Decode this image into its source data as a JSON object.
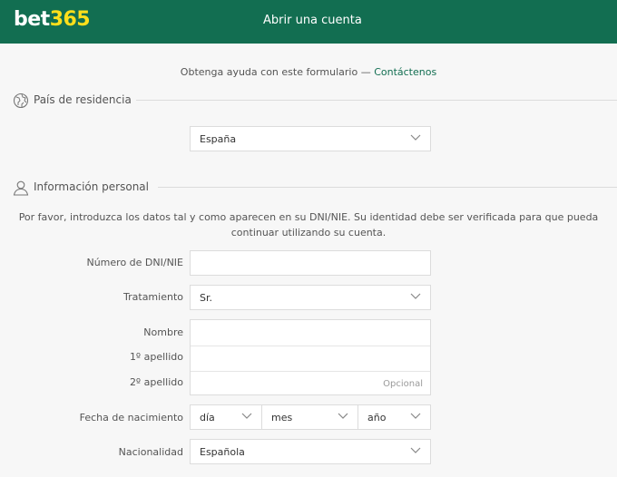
{
  "header": {
    "logo_part1": "bet",
    "logo_part2": "365",
    "title": "Abrir una cuenta",
    "bg_color": "#126e51",
    "logo_accent": "#ffdf1b"
  },
  "help": {
    "text": "Obtenga ayuda con este formulario — ",
    "link": "Contáctenos"
  },
  "residence": {
    "section_label": "País de residencia",
    "icon": "globe-icon",
    "country_value": "España"
  },
  "personal": {
    "section_label": "Información personal",
    "icon": "user-icon",
    "intro": "Por favor, introduzca los datos tal y como aparecen en su DNI/NIE. Su identidad debe ser verificada para que pueda continuar utilizando su cuenta.",
    "dni_label": "Número de DNI/NIE",
    "dni_value": "",
    "title_label": "Tratamiento",
    "title_value": "Sr.",
    "name_label": "Nombre",
    "surname1_label": "1º apellido",
    "surname2_label": "2º apellido",
    "surname2_placeholder": "Opcional",
    "dob_label": "Fecha de nacimiento",
    "dob_day": "día",
    "dob_month": "mes",
    "dob_year": "año",
    "nationality_label": "Nacionalidad",
    "nationality_value": "Española"
  }
}
